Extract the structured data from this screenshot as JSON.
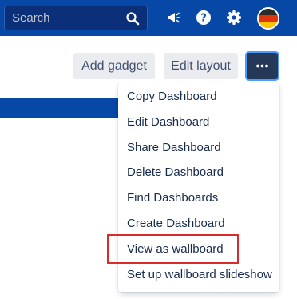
{
  "header": {
    "search": {
      "placeholder": "Search",
      "value": ""
    },
    "icons": [
      "search-icon",
      "megaphone-icon",
      "help-icon",
      "settings-gear-icon",
      "user-avatar"
    ],
    "background_color": "#0747a6"
  },
  "toolbar": {
    "add_gadget_label": "Add gadget",
    "edit_layout_label": "Edit layout",
    "more_icon": "ellipsis-icon"
  },
  "menu": {
    "items": [
      {
        "label": "Copy Dashboard"
      },
      {
        "label": "Edit Dashboard"
      },
      {
        "label": "Share Dashboard"
      },
      {
        "label": "Delete Dashboard"
      },
      {
        "label": "Find Dashboards"
      },
      {
        "label": "Create Dashboard"
      },
      {
        "label": "View as wallboard",
        "highlighted": true
      },
      {
        "label": "Set up wallboard slideshow"
      }
    ]
  },
  "colors": {
    "highlight_border": "#d92b2b",
    "more_button_bg": "#253858"
  }
}
